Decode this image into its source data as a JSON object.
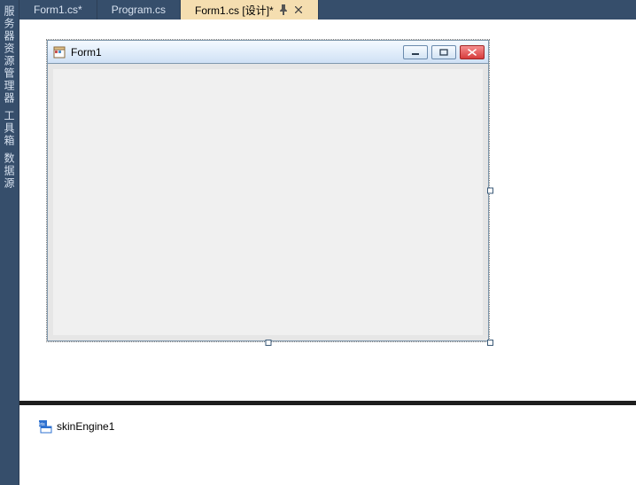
{
  "side_tabs": {
    "t0": "服务器资源管理器",
    "t1": "工具箱",
    "t2": "数据源"
  },
  "tabs": {
    "items": [
      {
        "label": "Form1.cs*"
      },
      {
        "label": "Program.cs"
      },
      {
        "label": "Form1.cs [设计]*"
      }
    ]
  },
  "form": {
    "title": "Form1"
  },
  "tray": {
    "item0": "skinEngine1"
  }
}
